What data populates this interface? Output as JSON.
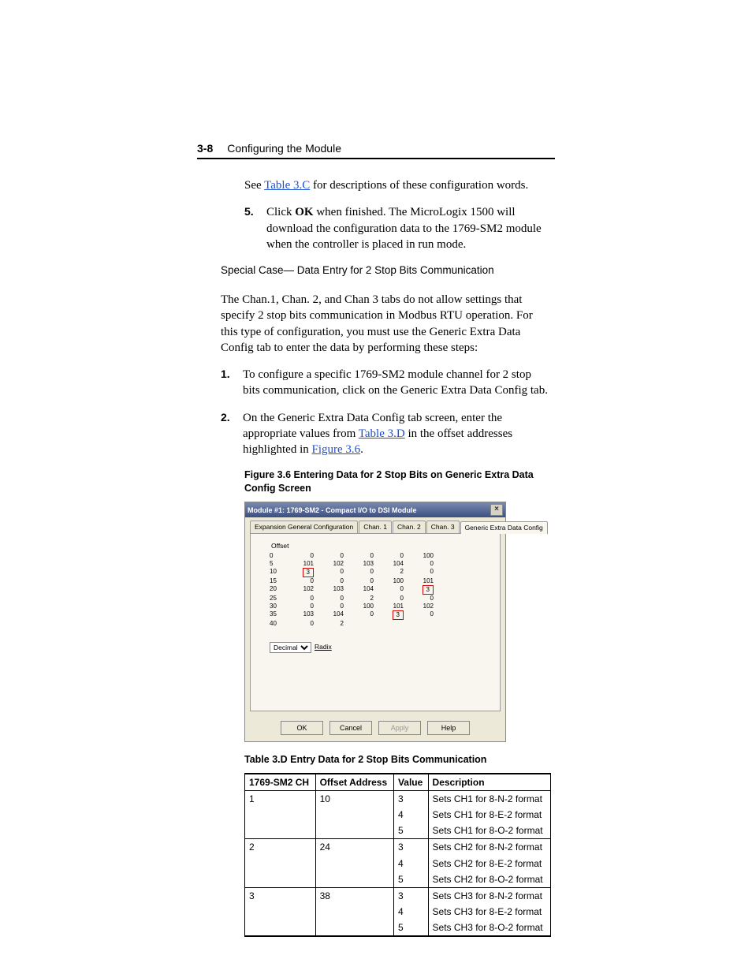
{
  "header": {
    "pagenum": "3-8",
    "section": "Configuring the Module"
  },
  "intro": {
    "see_pre": "See ",
    "see_link": "Table 3.C",
    "see_post": " for descriptions of these configuration words."
  },
  "step5": {
    "num": "5.",
    "pre": "Click ",
    "ok": "OK",
    "post": " when finished. The MicroLogix 1500 will download the configuration data to the 1769-SM2 module when the controller is placed in run mode."
  },
  "subhead": "Special Case— Data Entry for 2 Stop Bits Communication",
  "para2": "The Chan.1, Chan. 2, and Chan 3 tabs do not allow settings that specify 2 stop bits communication in Modbus RTU operation. For this type of configuration, you must use the Generic Extra Data Config tab to enter the data by performing these steps:",
  "step1": {
    "num": "1.",
    "text": "To configure a specific 1769-SM2 module channel for 2 stop bits communication, click on the Generic Extra Data Config tab."
  },
  "step2": {
    "num": "2.",
    "pre": "On the Generic Extra Data Config tab screen, enter the appropriate values from ",
    "link1": "Table 3.D",
    "mid": " in the offset addresses highlighted in ",
    "link2": "Figure 3.6",
    "post": "."
  },
  "figcap": "Figure 3.6   Entering Data for 2 Stop Bits on Generic Extra Data Config Screen",
  "dialog": {
    "title": "Module #1: 1769-SM2 - Compact I/O to DSI Module",
    "tabs": [
      "Expansion General Configuration",
      "Chan. 1",
      "Chan. 2",
      "Chan. 3",
      "Generic Extra Data Config"
    ],
    "offset_label": "Offset",
    "rows": [
      {
        "lbl": "0",
        "v": [
          "0",
          "0",
          "0",
          "0",
          "100"
        ]
      },
      {
        "lbl": "5",
        "v": [
          "101",
          "102",
          "103",
          "104",
          "0"
        ]
      },
      {
        "lbl": "10",
        "v": [
          "3",
          "0",
          "0",
          "2",
          "0"
        ],
        "red": [
          0
        ]
      },
      {
        "lbl": "15",
        "v": [
          "0",
          "0",
          "0",
          "100",
          "101"
        ]
      },
      {
        "lbl": "20",
        "v": [
          "102",
          "103",
          "104",
          "0",
          "3"
        ],
        "red": [
          4
        ]
      },
      {
        "lbl": "25",
        "v": [
          "0",
          "0",
          "2",
          "0",
          "0"
        ]
      },
      {
        "lbl": "30",
        "v": [
          "0",
          "0",
          "100",
          "101",
          "102"
        ]
      },
      {
        "lbl": "35",
        "v": [
          "103",
          "104",
          "0",
          "3",
          "0"
        ],
        "red": [
          3
        ]
      },
      {
        "lbl": "40",
        "v": [
          "0",
          "2",
          "",
          "",
          ""
        ]
      }
    ],
    "radix_options": [
      "Decimal"
    ],
    "radix_label": "Radix",
    "buttons": {
      "ok": "OK",
      "cancel": "Cancel",
      "apply": "Apply",
      "help": "Help"
    }
  },
  "tblcap": "Table 3.D   Entry Data for 2 Stop Bits Communication",
  "tableD": {
    "headers": [
      "1769-SM2 CH",
      "Offset Address",
      "Value",
      "Description"
    ],
    "groups": [
      {
        "ch": "1",
        "addr": "10",
        "rows": [
          {
            "val": "3",
            "desc": "Sets CH1 for 8-N-2 format"
          },
          {
            "val": "4",
            "desc": "Sets CH1 for 8-E-2 format"
          },
          {
            "val": "5",
            "desc": "Sets CH1 for 8-O-2 format"
          }
        ]
      },
      {
        "ch": "2",
        "addr": "24",
        "rows": [
          {
            "val": "3",
            "desc": "Sets CH2 for 8-N-2 format"
          },
          {
            "val": "4",
            "desc": "Sets CH2 for 8-E-2 format"
          },
          {
            "val": "5",
            "desc": "Sets CH2 for 8-O-2 format"
          }
        ]
      },
      {
        "ch": "3",
        "addr": "38",
        "rows": [
          {
            "val": "3",
            "desc": "Sets CH3 for 8-N-2 format"
          },
          {
            "val": "4",
            "desc": "Sets CH3 for 8-E-2 format"
          },
          {
            "val": "5",
            "desc": "Sets CH3 for 8-O-2 format"
          }
        ]
      }
    ]
  }
}
